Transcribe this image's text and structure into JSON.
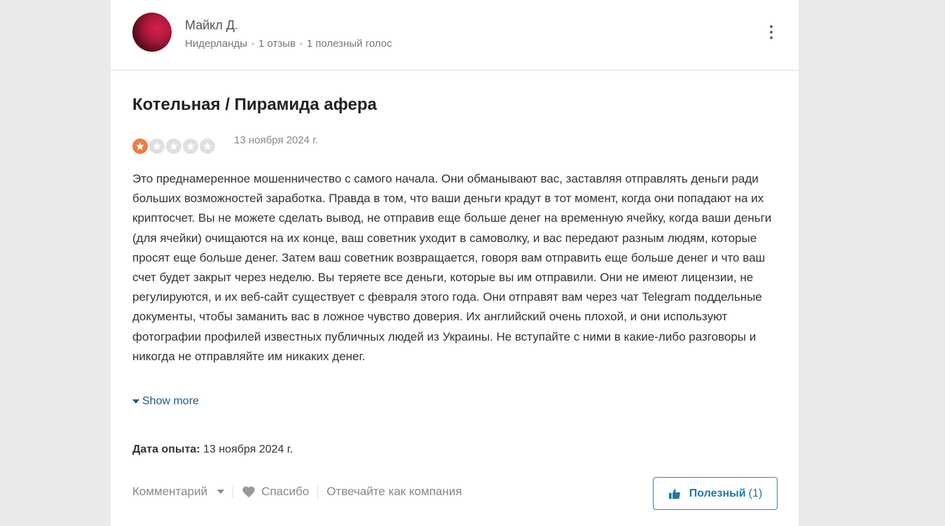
{
  "author": {
    "name": "Майкл Д.",
    "country": "Нидерланды",
    "reviews": "1 отзыв",
    "votes": "1 полезный голос"
  },
  "review": {
    "title": "Котельная / Пирамида афера",
    "rating": 1,
    "rating_max": 5,
    "date": "13 ноября 2024 г.",
    "text": "Это преднамеренное мошенничество с самого начала. Они обманывают вас, заставляя отправлять деньги ради больших возможностей заработка. Правда в том, что ваши деньги крадут в тот момент, когда они попадают на их криптосчет. Вы не можете сделать вывод, не отправив еще больше денег на временную ячейку, когда ваши деньги (для ячейки) очищаются на их конце, ваш советник уходит в самоволку, и вас передают разным людям, которые просят еще больше денег. Затем ваш советник возвращается, говоря вам отправить еще больше денег и что ваш счет будет закрыт через неделю. Вы теряете все деньги, которые вы им отправили. Они не имеют лицензии, не регулируются, и их веб-сайт существует с февраля этого года. Они отправят вам через чат Telegram поддельные документы, чтобы заманить вас в ложное чувство доверия. Их английский очень плохой, и они используют фотографии профилей известных публичных людей из Украины. Не вступайте с ними в какие-либо разговоры и никогда не отправляйте им никаких денег.",
    "show_more": "Show more",
    "experience_label": "Дата опыта:",
    "experience_date": "13 ноября 2024 г."
  },
  "actions": {
    "comment": "Комментарий",
    "thanks": "Спасибо",
    "reply_as_company": "Отвечайте как компания",
    "helpful_label": "Полезный",
    "helpful_count": "(1)"
  },
  "colors": {
    "star_filled": "#f07b3f",
    "star_empty": "#e0e0e0",
    "link": "#1a5c8a",
    "helpful_border": "#2a8bb5"
  }
}
